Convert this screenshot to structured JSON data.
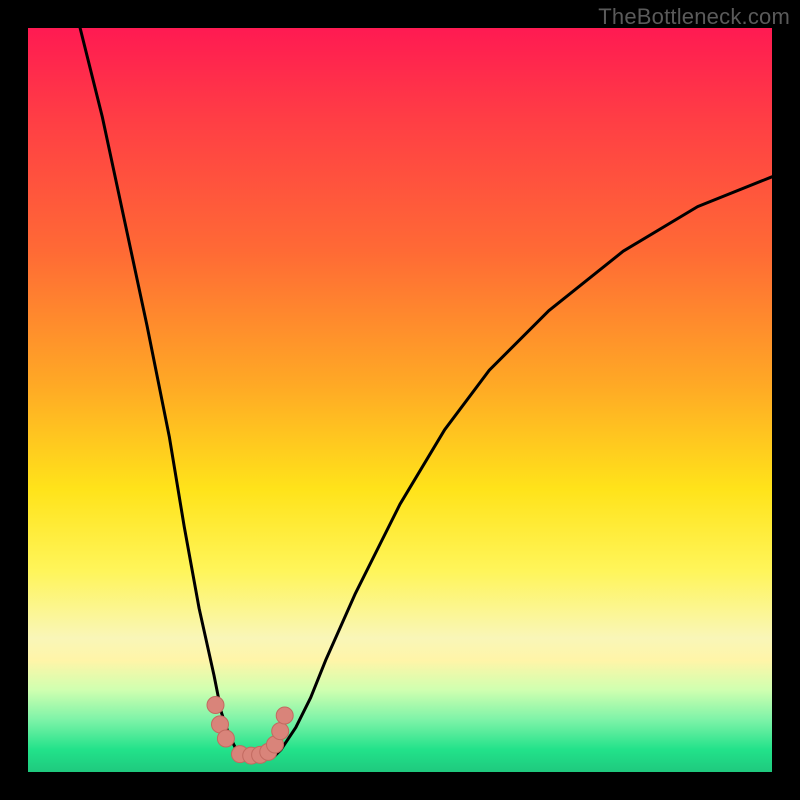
{
  "watermark": "TheBottleneck.com",
  "colors": {
    "frame": "#000000",
    "curve_stroke": "#000000",
    "marker_fill": "#d9847a",
    "marker_stroke": "#c26a60",
    "gradient_stops": [
      "#ff1a52",
      "#ff3d45",
      "#ff6a35",
      "#ffa925",
      "#ffe31a",
      "#fff55a",
      "#f9f6b8",
      "#fff5a8",
      "#cfffb0",
      "#7df3a8",
      "#22e28a",
      "#1fc97e"
    ]
  },
  "chart_data": {
    "type": "line",
    "title": "",
    "xlabel": "",
    "ylabel": "",
    "xlim": [
      0,
      100
    ],
    "ylim": [
      0,
      100
    ],
    "note": "No axis ticks or labels shown. Values estimated from pixel positions (0,0 = bottom-left of plot).",
    "series": [
      {
        "name": "curve",
        "x": [
          7,
          10,
          13,
          16,
          19,
          21,
          23,
          25,
          26,
          27,
          28,
          29,
          30,
          31,
          32,
          33,
          34,
          36,
          38,
          40,
          44,
          50,
          56,
          62,
          70,
          80,
          90,
          100
        ],
        "y": [
          100,
          88,
          74,
          60,
          45,
          33,
          22,
          13,
          8,
          5,
          3,
          2,
          2,
          2,
          2,
          2,
          3,
          6,
          10,
          15,
          24,
          36,
          46,
          54,
          62,
          70,
          76,
          80
        ]
      }
    ],
    "markers": {
      "name": "highlight-points",
      "style": "salmon-circles",
      "x": [
        25.2,
        25.8,
        26.6,
        28.5,
        30.0,
        31.2,
        32.3,
        33.2,
        33.9,
        34.5
      ],
      "y": [
        9.0,
        6.4,
        4.5,
        2.4,
        2.2,
        2.3,
        2.7,
        3.7,
        5.5,
        7.6
      ]
    }
  }
}
